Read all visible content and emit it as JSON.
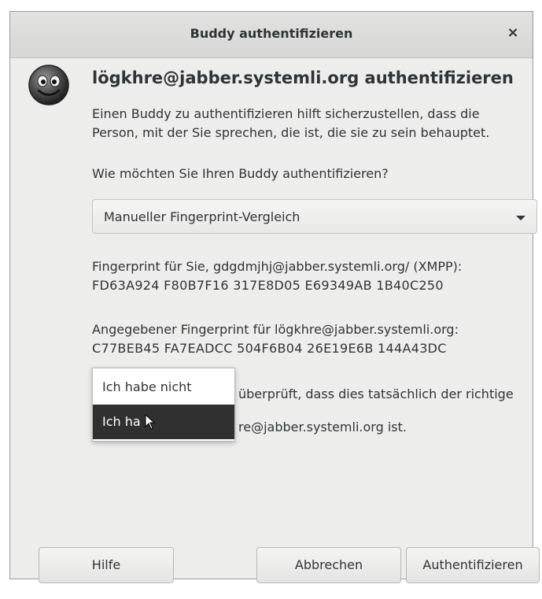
{
  "window": {
    "title": "Buddy authentifizieren",
    "close_glyph": "×"
  },
  "avatar": {
    "icon": "smiley-face-icon"
  },
  "heading": "lögkhre@jabber.systemli.org authentifizieren",
  "intro_line1": "Einen Buddy zu authentifizieren hilft sicherzustellen, dass die",
  "intro_line2": "Person, mit der Sie sprechen, die ist, die sie zu sein behauptet.",
  "question": "Wie möchten Sie Ihren Buddy authentifizieren?",
  "method_combo": {
    "selected": "Manueller Fingerprint-Vergleich"
  },
  "own_fingerprint": {
    "label": "Fingerprint für Sie, gdgdmjhj@jabber.systemli.org/ (XMPP):",
    "value": "FD63A924 F80B7F16 317E8D05 E69349AB 1B40C250"
  },
  "buddy_fingerprint": {
    "label": "Angegebener Fingerprint für lögkhre@jabber.systemli.org:",
    "value": "C77BEB45 FA7EADCC 504F6B04 26E19E6B 144A43DC"
  },
  "verify": {
    "text_line1": "überprüft, dass dies tatsächlich der richtige",
    "text_line2": "re@jabber.systemli.org ist.",
    "options": [
      "Ich habe nicht",
      "Ich ha"
    ],
    "highlighted_index": 1
  },
  "buttons": {
    "help": "Hilfe",
    "cancel": "Abbrechen",
    "authenticate": "Authentifizieren"
  }
}
